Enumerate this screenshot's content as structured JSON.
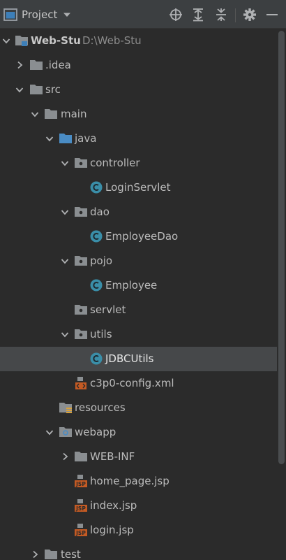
{
  "toolbar": {
    "title": "Project",
    "icons": [
      "project-window-icon",
      "chevron-down-icon",
      "locate-icon",
      "expand-all-icon",
      "collapse-all-icon",
      "gear-icon",
      "minimize-icon"
    ]
  },
  "tree": {
    "root": {
      "label": "Web-Stu",
      "path": "D:\\Web-Stu"
    },
    "idea": "idea_label_placeholder",
    "items": {
      "idea": ".idea",
      "src": "src",
      "main": "main",
      "java": "java",
      "controller": "controller",
      "login_servlet": "LoginServlet",
      "dao": "dao",
      "employee_dao": "EmployeeDao",
      "pojo": "pojo",
      "employee": "Employee",
      "servlet": "servlet",
      "utils": "utils",
      "jdbc_utils": "JDBCUtils",
      "c3p0_config": "c3p0-config.xml",
      "resources": "resources",
      "webapp": "webapp",
      "web_inf": "WEB-INF",
      "home_page": "home_page.jsp",
      "index": "index.jsp",
      "login": "login.jsp",
      "test": "test"
    },
    "selected": "JDBCUtils"
  },
  "colors": {
    "background": "#2b2b2b",
    "toolbar": "#3c3f41",
    "selection": "#46484a",
    "folder": "#8a8e91",
    "source_folder": "#4a8cc4",
    "class_icon": "#3a8ea8",
    "jsp_icon": "#c45a23"
  }
}
